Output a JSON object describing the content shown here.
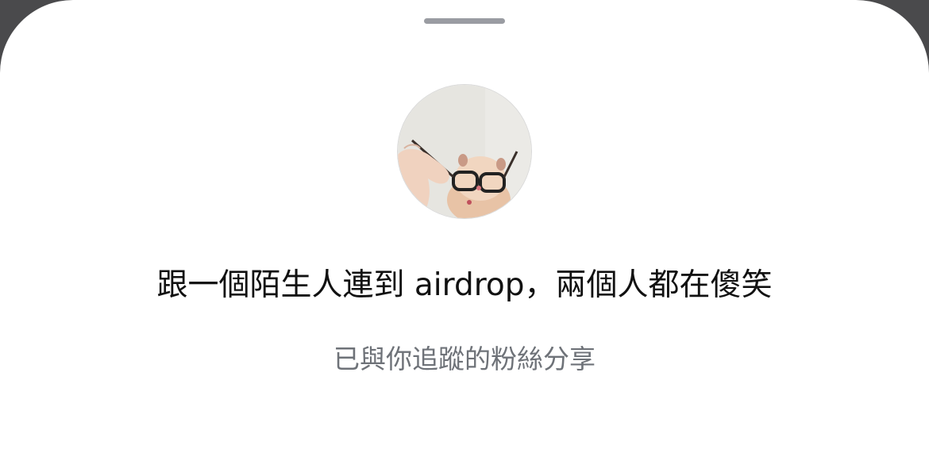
{
  "post": {
    "caption": "跟一個陌生人連到 airdrop，兩個人都在傻笑",
    "share_status": "已與你追蹤的粉絲分享"
  },
  "avatar": {
    "description_icon": "hamster-with-glasses-photo"
  },
  "colors": {
    "sheet_background": "#ffffff",
    "backdrop": "#4a4a4c",
    "grabber": "#9a9ca2",
    "caption_text": "#111111",
    "subtitle_text": "#6e7278"
  }
}
